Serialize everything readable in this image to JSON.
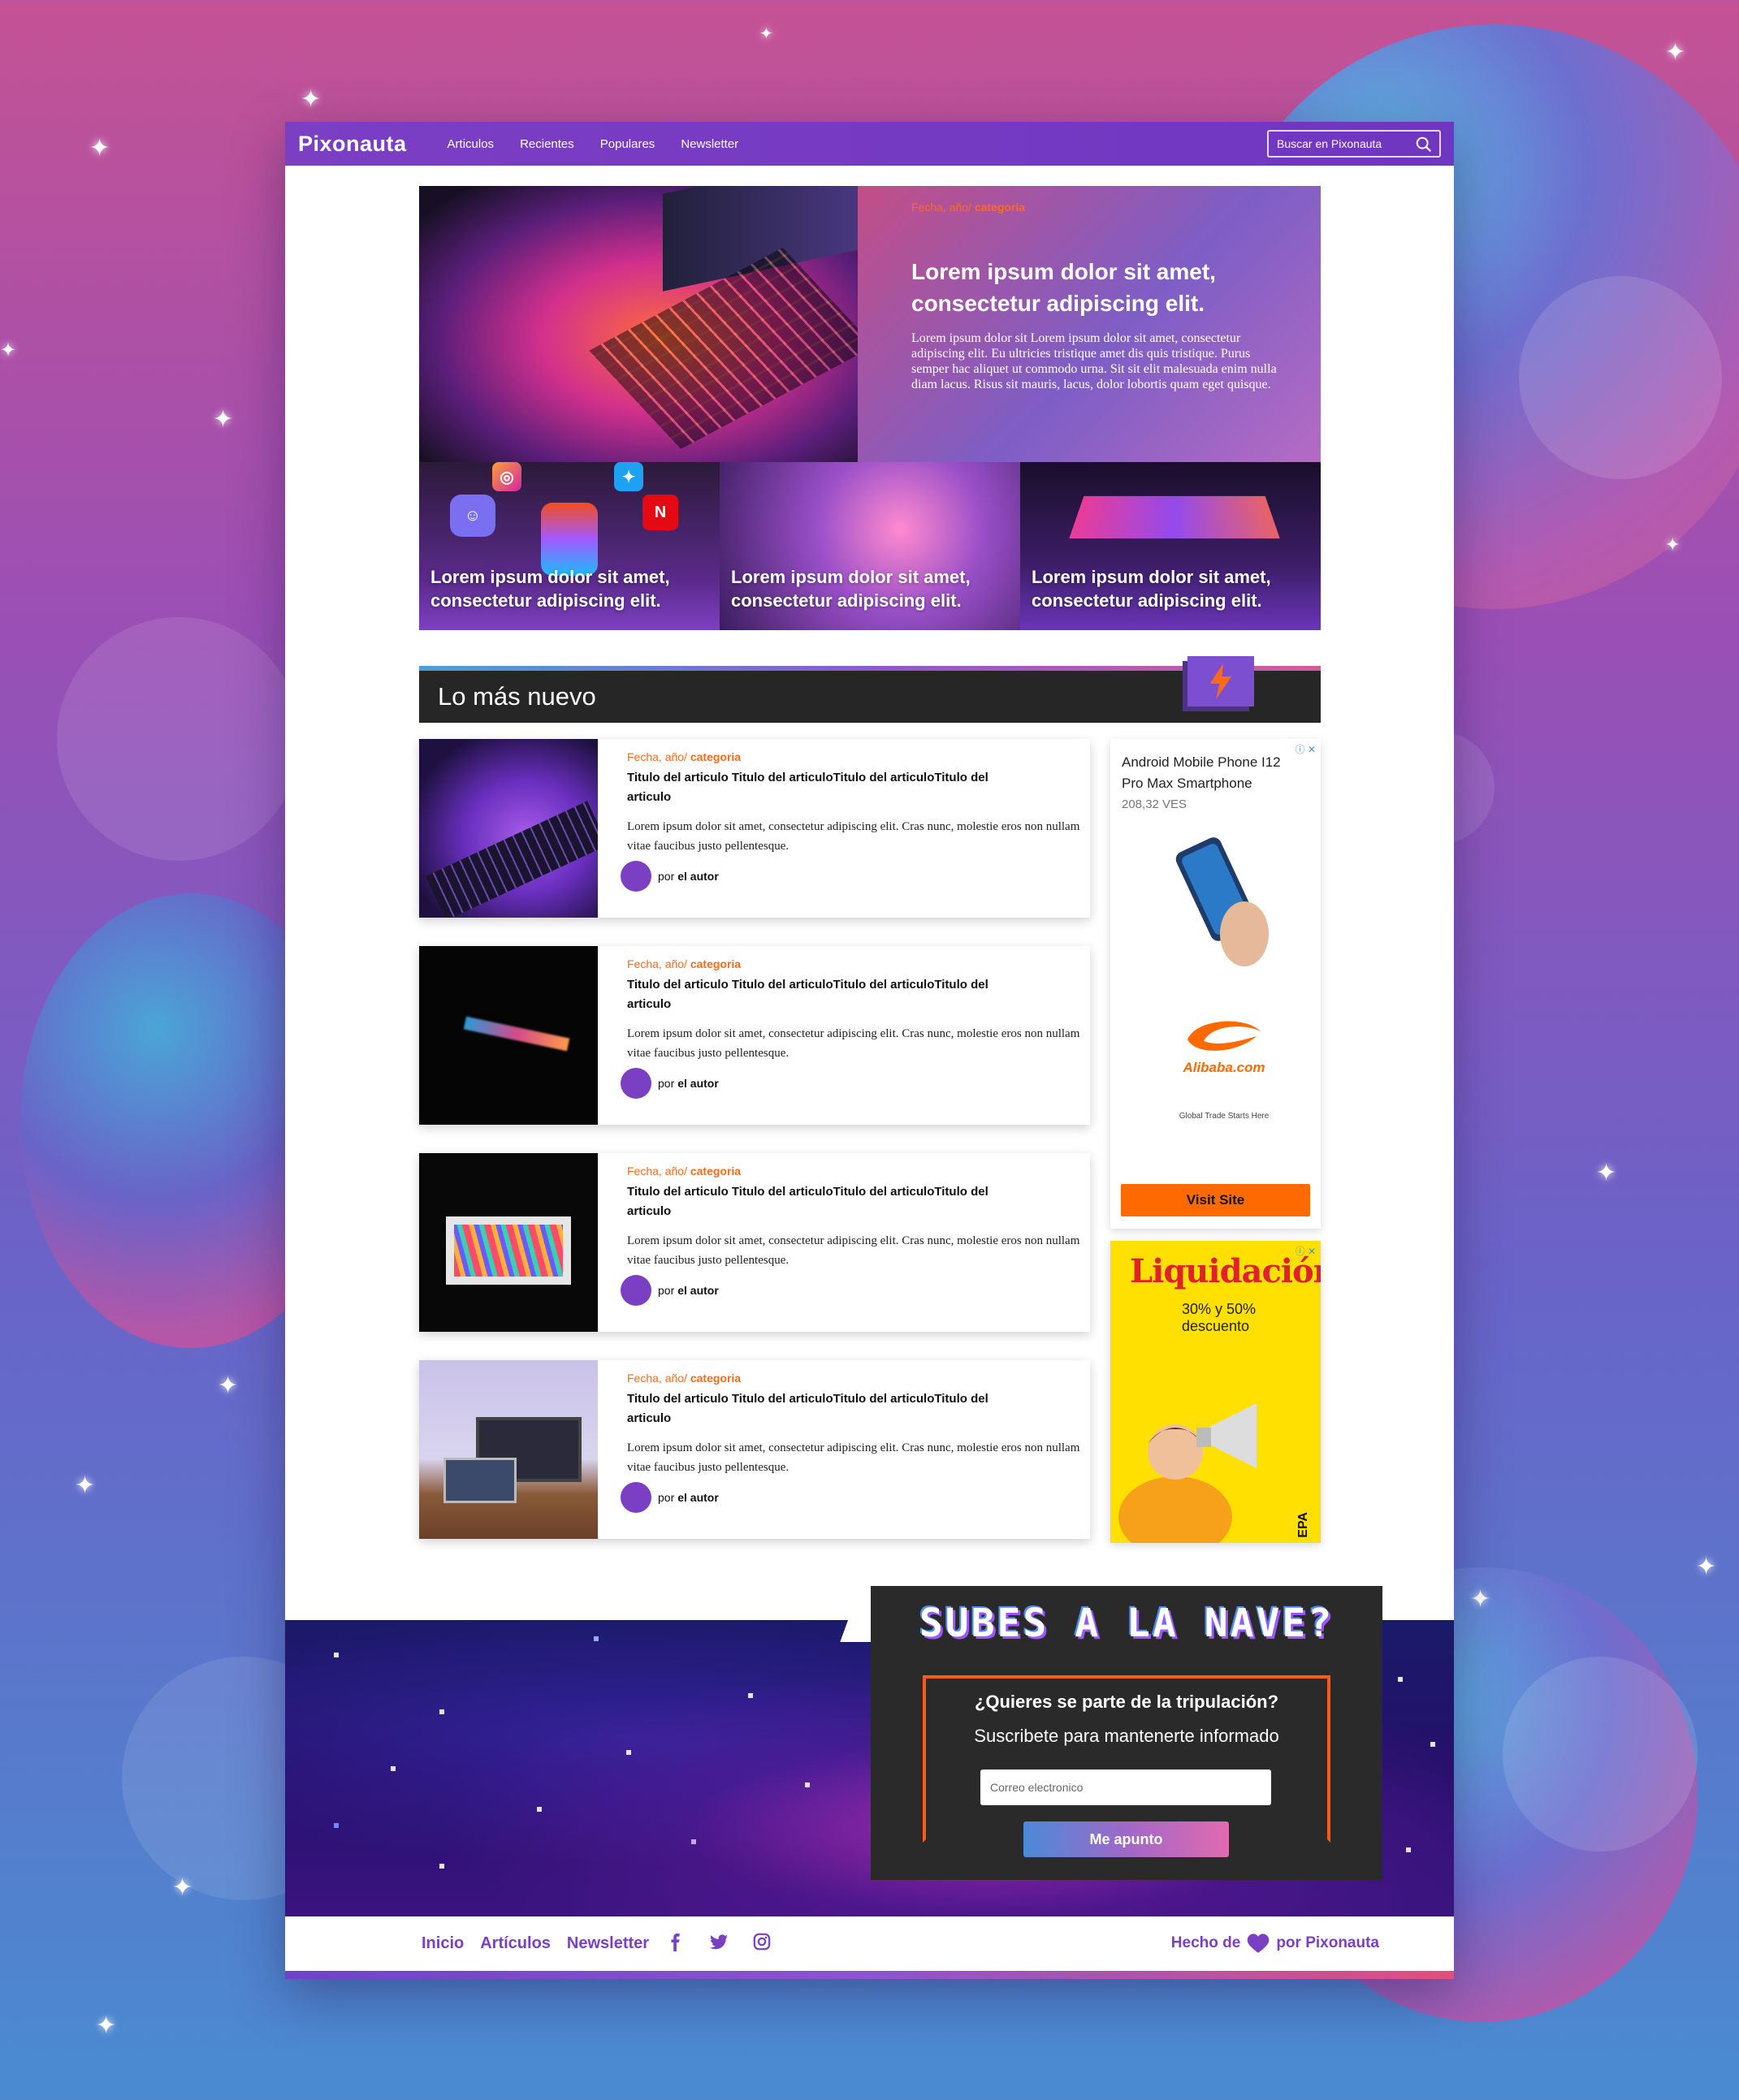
{
  "header": {
    "logo": "Pixonauta",
    "nav": [
      "Articulos",
      "Recientes",
      "Populares",
      "Newsletter"
    ],
    "search_placeholder": "Buscar en Pixonauta"
  },
  "hero": {
    "meta_date": "Fecha, año/",
    "meta_category": "categoria",
    "title": "Lorem ipsum dolor sit amet, consectetur adipiscing elit.",
    "text": "Lorem ipsum dolor sit Lorem ipsum dolor sit amet, consectetur adipiscing elit. Eu ultricies tristique amet dis quis tristique. Purus semper hac aliquet ut commodo urna. Sit sit elit malesuada enim nulla diam lacus. Risus sit mauris, lacus, dolor lobortis quam eget quisque."
  },
  "tiles": [
    {
      "title": "Lorem ipsum dolor sit amet, consectetur adipiscing elit."
    },
    {
      "title": "Lorem ipsum dolor sit amet, consectetur adipiscing elit."
    },
    {
      "title": "Lorem ipsum dolor sit amet, consectetur adipiscing elit."
    }
  ],
  "section_title": "Lo más nuevo",
  "articles": [
    {
      "date": "Fecha, año/",
      "category": "categoria",
      "title": "Titulo del articulo Titulo del articuloTitulo del articuloTitulo del articulo",
      "excerpt": "Lorem ipsum dolor sit amet, consectetur adipiscing elit. Cras nunc, molestie eros non nullam vitae faucibus justo pellentesque.",
      "by": "por",
      "author": "el autor"
    },
    {
      "date": "Fecha, año/",
      "category": "categoria",
      "title": "Titulo del articulo Titulo del articuloTitulo del articuloTitulo del articulo",
      "excerpt": "Lorem ipsum dolor sit amet, consectetur adipiscing elit. Cras nunc, molestie eros non nullam vitae faucibus justo pellentesque.",
      "by": "por",
      "author": "el autor"
    },
    {
      "date": "Fecha, año/",
      "category": "categoria",
      "title": "Titulo del articulo Titulo del articuloTitulo del articuloTitulo del articulo",
      "excerpt": "Lorem ipsum dolor sit amet, consectetur adipiscing elit. Cras nunc, molestie eros non nullam vitae faucibus justo pellentesque.",
      "by": "por",
      "author": "el autor"
    },
    {
      "date": "Fecha, año/",
      "category": "categoria",
      "title": "Titulo del articulo Titulo del articuloTitulo del articuloTitulo del articulo",
      "excerpt": "Lorem ipsum dolor sit amet, consectetur adipiscing elit. Cras nunc, molestie eros non nullam vitae faucibus justo pellentesque.",
      "by": "por",
      "author": "el autor"
    }
  ],
  "ad1": {
    "product": "Android Mobile Phone I12 Pro Max Smartphone",
    "price": "208,32 VES",
    "brand": "Alibaba.com",
    "tagline": "Global Trade Starts Here",
    "cta": "Visit Site"
  },
  "ad2": {
    "title": "Liquidación",
    "subtitle": "30% y 50% descuento",
    "brand": "EPA"
  },
  "newsletter": {
    "headline": "SUBES A LA NAVE?",
    "question": "¿Quieres se parte de la tripulación?",
    "subtitle": "Suscribete para mantenerte informado",
    "email_placeholder": "Correo electronico",
    "button": "Me apunto"
  },
  "footer": {
    "links": [
      "Inicio",
      "Artículos",
      "Newsletter"
    ],
    "credit_prefix": "Hecho de",
    "credit_suffix": "por Pixonauta"
  },
  "colors": {
    "brand_purple": "#7b3fc4",
    "accent_orange": "#ff6a1a"
  }
}
